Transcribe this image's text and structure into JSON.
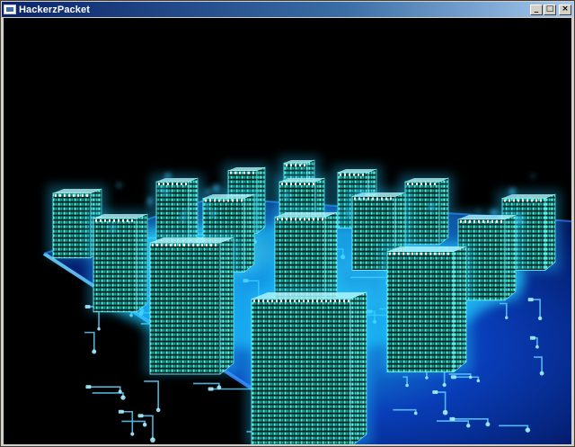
{
  "window": {
    "title": "HackerzPacket",
    "minimize_glyph": "_",
    "maximize_glyph": "□",
    "close_glyph": "×",
    "titlebar_color": "#0a246a"
  },
  "scene": {
    "background_color": "#000000",
    "grid_color": "#1a6cff",
    "glow_color": "#35e0ff",
    "tower_color": "#2ef2d5",
    "description_icon": "circuit-city-scene"
  }
}
